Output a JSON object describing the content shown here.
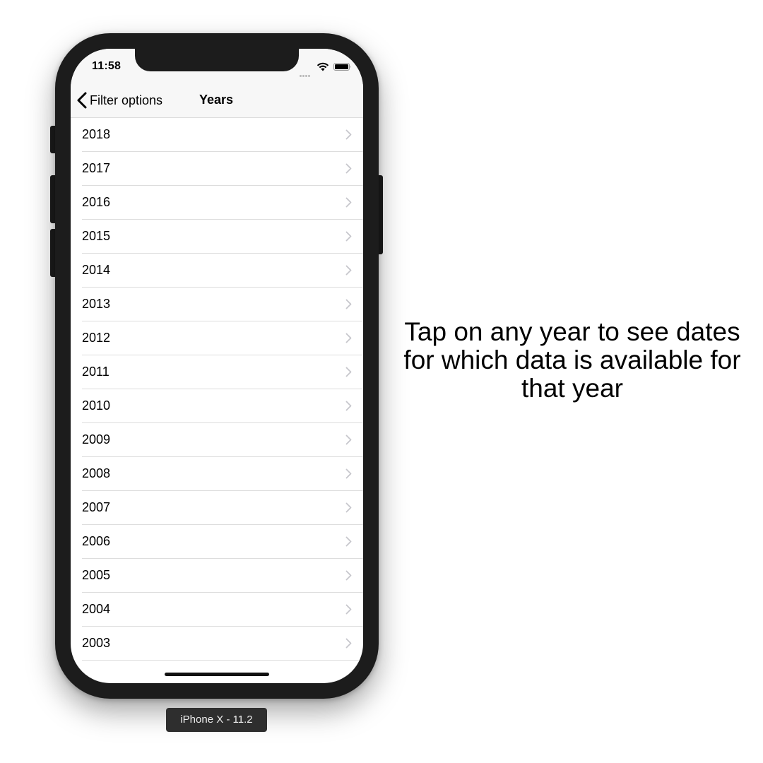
{
  "status_bar": {
    "time": "11:58",
    "icons": [
      "signal-dots-icon",
      "wifi-icon",
      "battery-icon"
    ]
  },
  "nav": {
    "back_label": "Filter options",
    "title": "Years"
  },
  "years": [
    "2018",
    "2017",
    "2016",
    "2015",
    "2014",
    "2013",
    "2012",
    "2011",
    "2010",
    "2009",
    "2008",
    "2007",
    "2006",
    "2005",
    "2004",
    "2003"
  ],
  "device_label": "iPhone X - 11.2",
  "caption": {
    "line1": "Tap on any year to see dates",
    "line2": "for which data is available for",
    "line3": "that year"
  },
  "colors": {
    "phone_body": "#1c1c1c",
    "bar_background": "#f7f7f7",
    "separator": "#dddddd",
    "chevron": "#c7c7cc"
  }
}
